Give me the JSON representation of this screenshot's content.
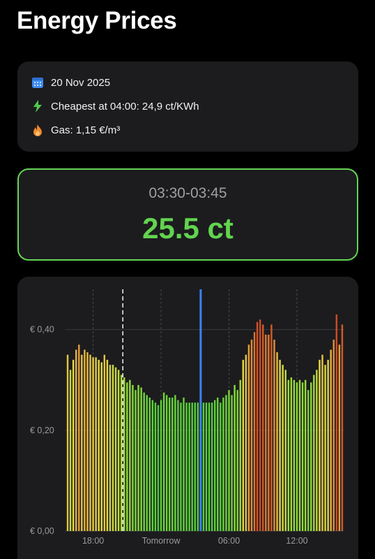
{
  "header": {
    "title": "Energy Prices"
  },
  "info": {
    "date": "20 Nov 2025",
    "cheapest": "Cheapest at 04:00: 24,9 ct/KWh",
    "gas": "Gas: 1,15 €/m³",
    "icons": [
      "calendar-icon",
      "lightning-bolt-icon",
      "flame-icon"
    ]
  },
  "current": {
    "time_range": "03:30-03:45",
    "price": "25.5 ct",
    "accent_color": "#62d44f"
  },
  "chart_data": {
    "type": "bar",
    "ylim": [
      0,
      0.48
    ],
    "y_ticks": [
      {
        "value": 0,
        "label": "€ 0,00"
      },
      {
        "value": 0.2,
        "label": "€ 0,20"
      },
      {
        "value": 0.4,
        "label": "€ 0,40"
      }
    ],
    "x_ticks": [
      {
        "index": 9,
        "label": "18:00"
      },
      {
        "index": 33,
        "label": "Tomorrow"
      },
      {
        "index": 57,
        "label": "06:00"
      },
      {
        "index": 81,
        "label": "12:00"
      }
    ],
    "now_index": 20,
    "selected_index": 47,
    "values": [
      0.35,
      0.32,
      0.34,
      0.36,
      0.37,
      0.35,
      0.36,
      0.355,
      0.35,
      0.345,
      0.345,
      0.34,
      0.335,
      0.35,
      0.34,
      0.33,
      0.33,
      0.325,
      0.32,
      0.31,
      0.305,
      0.295,
      0.3,
      0.29,
      0.28,
      0.29,
      0.285,
      0.275,
      0.27,
      0.265,
      0.26,
      0.255,
      0.25,
      0.26,
      0.275,
      0.27,
      0.265,
      0.265,
      0.27,
      0.26,
      0.255,
      0.265,
      0.255,
      0.255,
      0.255,
      0.255,
      0.255,
      0.255,
      0.255,
      0.255,
      0.255,
      0.255,
      0.26,
      0.265,
      0.255,
      0.265,
      0.27,
      0.28,
      0.27,
      0.29,
      0.28,
      0.3,
      0.34,
      0.35,
      0.37,
      0.38,
      0.395,
      0.415,
      0.42,
      0.41,
      0.39,
      0.39,
      0.41,
      0.38,
      0.355,
      0.34,
      0.33,
      0.32,
      0.3,
      0.305,
      0.3,
      0.295,
      0.3,
      0.295,
      0.3,
      0.28,
      0.295,
      0.31,
      0.32,
      0.34,
      0.35,
      0.33,
      0.34,
      0.36,
      0.38,
      0.43,
      0.37,
      0.41
    ]
  }
}
